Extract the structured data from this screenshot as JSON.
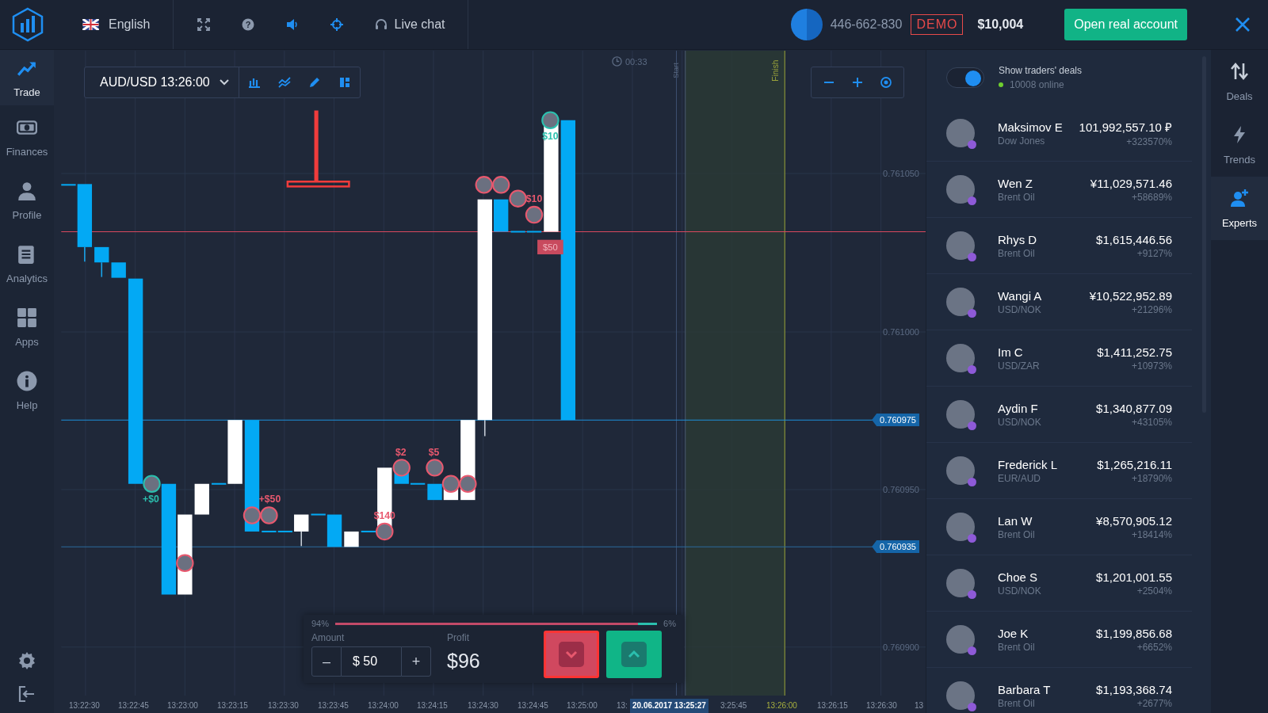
{
  "top_bar": {
    "language": "English",
    "help_glyph": "?",
    "live_chat": "Live chat",
    "account_id": "446-662-830",
    "mode_badge": "DEMO",
    "balance": "$10,004",
    "open_account_button": "Open real account"
  },
  "left_nav": [
    {
      "label": "Trade",
      "kind": "trade",
      "selected": true
    },
    {
      "label": "Finances",
      "kind": "finances",
      "selected": false
    },
    {
      "label": "Profile",
      "kind": "profile",
      "selected": false
    },
    {
      "label": "Analytics",
      "kind": "analytics",
      "selected": false
    },
    {
      "label": "Apps",
      "kind": "apps",
      "selected": false
    },
    {
      "label": "Help",
      "kind": "help",
      "selected": false
    }
  ],
  "chart": {
    "asset_selector": "AUD/USD 13:26:00",
    "timer": "00:33",
    "start_label": "Start",
    "finish_label": "Finish",
    "price_axis": [
      {
        "label": "0.761050",
        "kind": "tick"
      },
      {
        "label": "0.761000",
        "kind": "tick"
      },
      {
        "label": "0.760975",
        "kind": "marker"
      },
      {
        "label": "0.760950",
        "kind": "tick"
      },
      {
        "label": "0.760935",
        "kind": "marker"
      },
      {
        "label": "0.760900",
        "kind": "tick"
      }
    ],
    "time_axis": [
      {
        "label": "13:22:30",
        "kind": "tick"
      },
      {
        "label": "13:22:45",
        "kind": "tick"
      },
      {
        "label": "13:23:00",
        "kind": "tick"
      },
      {
        "label": "13:23:15",
        "kind": "tick"
      },
      {
        "label": "13:23:30",
        "kind": "tick"
      },
      {
        "label": "13:23:45",
        "kind": "tick"
      },
      {
        "label": "13:24:00",
        "kind": "tick"
      },
      {
        "label": "13:24:15",
        "kind": "tick"
      },
      {
        "label": "13:24:30",
        "kind": "tick"
      },
      {
        "label": "13:24:45",
        "kind": "tick"
      },
      {
        "label": "13:25:00",
        "kind": "tick"
      },
      {
        "label": "13:",
        "kind": "tick"
      },
      {
        "label": "20.06.2017 13:25:27",
        "kind": "cursor"
      },
      {
        "label": "3:25:45",
        "kind": "tick"
      },
      {
        "label": "13:26:00",
        "kind": "finish"
      },
      {
        "label": "13:26:15",
        "kind": "tick"
      },
      {
        "label": "13:26:30",
        "kind": "tick"
      },
      {
        "label": "13",
        "kind": "tick"
      }
    ],
    "deal_labels": [
      {
        "text": "$10",
        "kind": "text",
        "color": "#2bbfae"
      },
      {
        "text": "$10",
        "kind": "text",
        "color": "#e8586e"
      },
      {
        "text": "$50",
        "kind": "badge",
        "color": "#c84a5e"
      },
      {
        "text": "+$0",
        "kind": "text",
        "color": "#2bbfae"
      },
      {
        "text": "+$50",
        "kind": "text",
        "color": "#e8586e"
      },
      {
        "text": "$140",
        "kind": "text",
        "color": "#e8586e"
      },
      {
        "text": "$2",
        "kind": "text",
        "color": "#e8586e"
      },
      {
        "text": "$5",
        "kind": "text",
        "color": "#e8586e"
      }
    ]
  },
  "trade_panel": {
    "down_share": "94%",
    "level": 0.94,
    "up_share": "6%",
    "amount_label": "Amount",
    "decrease": "–",
    "amount_value": "$ 50",
    "increase": "+",
    "profit_label": "Profit",
    "profit_value": "$96"
  },
  "right_panel": {
    "show_deals": {
      "label": "Show traders' deals",
      "on": true,
      "online": "10008 online"
    },
    "traders": [
      {
        "name": "Maksimov E",
        "asset": "Dow Jones",
        "amount": "101,992,557.10 ₽",
        "gain": "+323570%"
      },
      {
        "name": "Wen Z",
        "asset": "Brent Oil",
        "amount": "¥11,029,571.46",
        "gain": "+58689%"
      },
      {
        "name": "Rhys D",
        "asset": "Brent Oil",
        "amount": "$1,615,446.56",
        "gain": "+9127%"
      },
      {
        "name": "Wangi A",
        "asset": "USD/NOK",
        "amount": "¥10,522,952.89",
        "gain": "+21296%"
      },
      {
        "name": "Im C",
        "asset": "USD/ZAR",
        "amount": "$1,411,252.75",
        "gain": "+10973%"
      },
      {
        "name": "Aydin F",
        "asset": "USD/NOK",
        "amount": "$1,340,877.09",
        "gain": "+43105%"
      },
      {
        "name": "Frederick L",
        "asset": "EUR/AUD",
        "amount": "$1,265,216.11",
        "gain": "+18790%"
      },
      {
        "name": "Lan W",
        "asset": "Brent Oil",
        "amount": "¥8,570,905.12",
        "gain": "+18414%"
      },
      {
        "name": "Choe S",
        "asset": "USD/NOK",
        "amount": "$1,201,001.55",
        "gain": "+2504%"
      },
      {
        "name": "Joe K",
        "asset": "Brent Oil",
        "amount": "$1,199,856.68",
        "gain": "+6652%"
      },
      {
        "name": "Barbara T",
        "asset": "Brent Oil",
        "amount": "$1,193,368.74",
        "gain": "+2677%"
      }
    ]
  },
  "right_tabs": [
    {
      "label": "Deals",
      "kind": "deals",
      "selected": false
    },
    {
      "label": "Trends",
      "kind": "trends",
      "selected": false
    },
    {
      "label": "Experts",
      "kind": "experts",
      "selected": true
    }
  ]
}
